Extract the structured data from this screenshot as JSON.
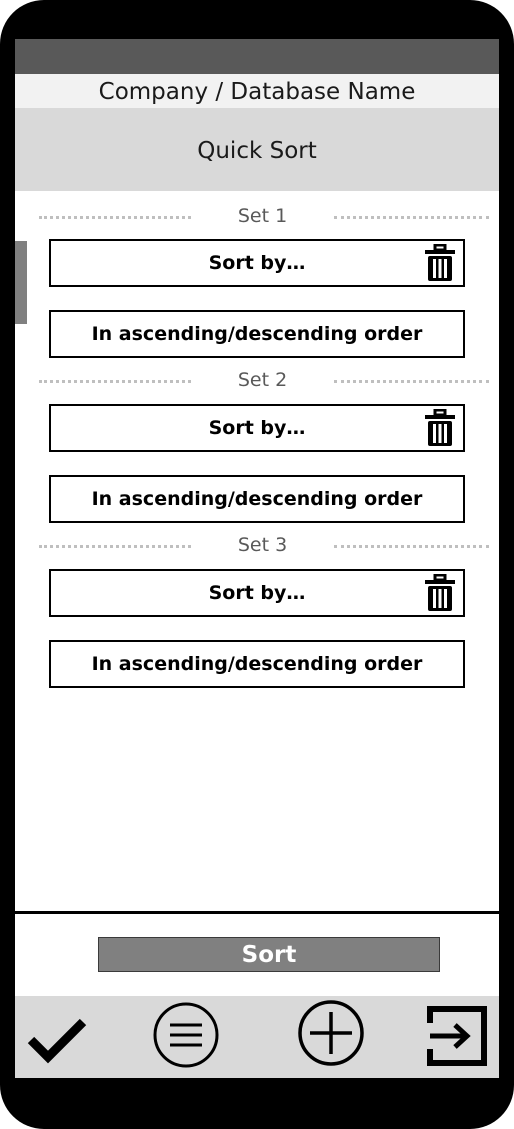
{
  "header": {
    "company_name": "Company / Database Name",
    "title": "Quick Sort"
  },
  "sets": [
    {
      "label": "Set 1",
      "sort_by": "Sort by…",
      "order": "In ascending/descending order"
    },
    {
      "label": "Set 2",
      "sort_by": "Sort by…",
      "order": "In ascending/descending order"
    },
    {
      "label": "Set 3",
      "sort_by": "Sort by…",
      "order": "In ascending/descending order"
    }
  ],
  "actions": {
    "sort_label": "Sort"
  },
  "toolbar": {
    "icons": [
      "checkmark-icon",
      "menu-icon",
      "add-icon",
      "exit-icon"
    ]
  },
  "colors": {
    "status_bar": "#595959",
    "company_bar": "#f2f2f2",
    "title_bar": "#d9d9d9",
    "sort_button": "#808080",
    "toolbar": "#d9d9d9"
  }
}
